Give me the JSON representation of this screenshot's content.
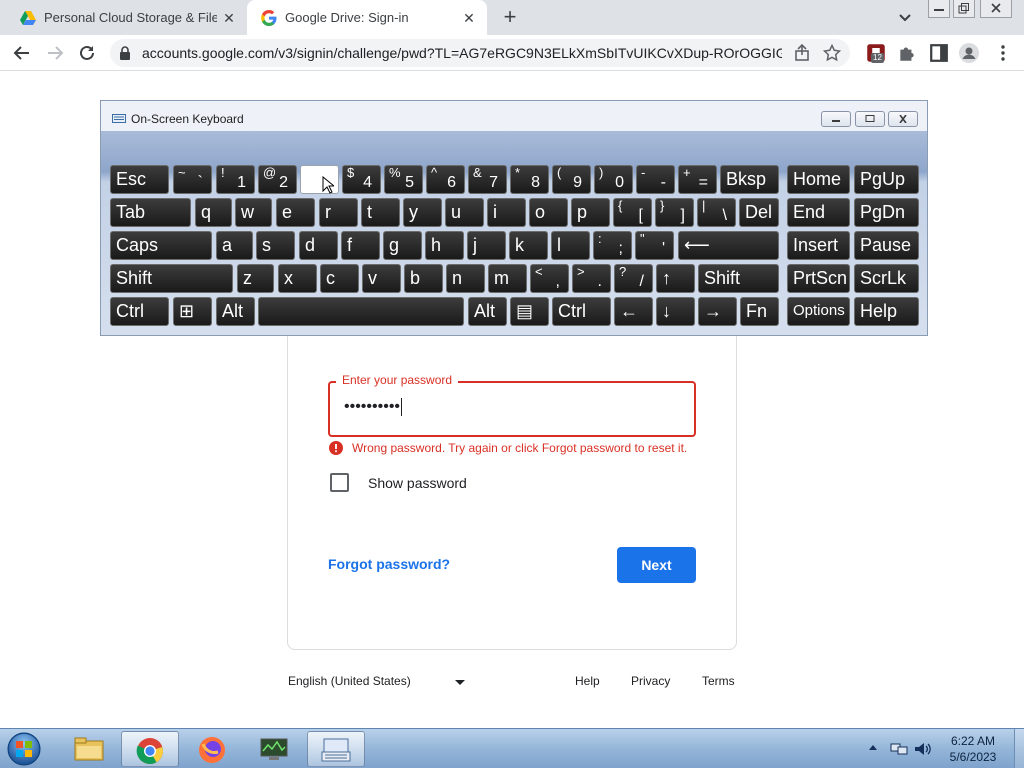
{
  "browser": {
    "tabs": [
      {
        "title": "Personal Cloud Storage & File Sh",
        "active": false
      },
      {
        "title": "Google Drive: Sign-in",
        "active": true
      }
    ],
    "new_tab_label": "+",
    "url": "accounts.google.com/v3/signin/challenge/pwd?TL=AG7eRGC9N3ELkXmSbITvUIKCvXDup-ROrOGGIG...",
    "extension_badge": "12"
  },
  "signin": {
    "password_label": "Enter your password",
    "password_value": "••••••••••",
    "error_text": "Wrong password. Try again or click Forgot password to reset it.",
    "show_password_label": "Show password",
    "forgot_password_label": "Forgot password?",
    "next_label": "Next",
    "footer": {
      "language": "English (United States)",
      "help": "Help",
      "privacy": "Privacy",
      "terms": "Terms"
    }
  },
  "osk": {
    "title": "On-Screen Keyboard",
    "keys": {
      "esc": "Esc",
      "tilde_sub": "~",
      "tilde_low": "`",
      "k1_sub": "!",
      "k1": "1",
      "k2_sub": "@",
      "k2": "2",
      "k4_sub": "$",
      "k4": "4",
      "k5_sub": "%",
      "k5": "5",
      "k6_sub": "^",
      "k6": "6",
      "k7_sub": "&",
      "k7": "7",
      "k8_sub": "*",
      "k8": "8",
      "k9_sub": "(",
      "k9": "9",
      "k0_sub": ")",
      "k0": "0",
      "minus_sub": "-",
      "minus": "-",
      "plus_sub": "+",
      "plus": "=",
      "bksp": "Bksp",
      "home": "Home",
      "pgup": "PgUp",
      "tab": "Tab",
      "q": "q",
      "w": "w",
      "e": "e",
      "r": "r",
      "t": "t",
      "y": "y",
      "u": "u",
      "i": "i",
      "o": "o",
      "p": "p",
      "lbracket_sub": "{",
      "lbracket": "[",
      "rbracket_sub": "}",
      "rbracket": "]",
      "bslash_sub": "|",
      "bslash": "\\",
      "del": "Del",
      "end": "End",
      "pgdn": "PgDn",
      "caps": "Caps",
      "a": "a",
      "s": "s",
      "d": "d",
      "f": "f",
      "g": "g",
      "h": "h",
      "j": "j",
      "k": "k",
      "l": "l",
      "semi_sub": ":",
      "semi": ";",
      "quote_sub": "\"",
      "quote": "'",
      "enter": "⟵",
      "insert": "Insert",
      "pause": "Pause",
      "shift": "Shift",
      "z": "z",
      "x": "x",
      "c": "c",
      "v": "v",
      "b": "b",
      "n": "n",
      "m": "m",
      "comma_sub": "<",
      "comma": ",",
      "period_sub": ">",
      "period": ".",
      "slash_sub": "?",
      "slash": "/",
      "up": "↑",
      "shift_r": "Shift",
      "prtscn": "PrtScn",
      "scrlk": "ScrLk",
      "ctrl": "Ctrl",
      "win": "⊞",
      "alt": "Alt",
      "alt_r": "Alt",
      "menu": "▤",
      "ctrl_r": "Ctrl",
      "left": "←",
      "down": "↓",
      "right": "→",
      "fn": "Fn",
      "options": "Options",
      "help": "Help"
    }
  },
  "taskbar": {
    "time": "6:22 AM",
    "date": "5/6/2023"
  },
  "colors": {
    "accent": "#1a73e8",
    "error": "#d93025",
    "key": "#1f1f1f"
  }
}
